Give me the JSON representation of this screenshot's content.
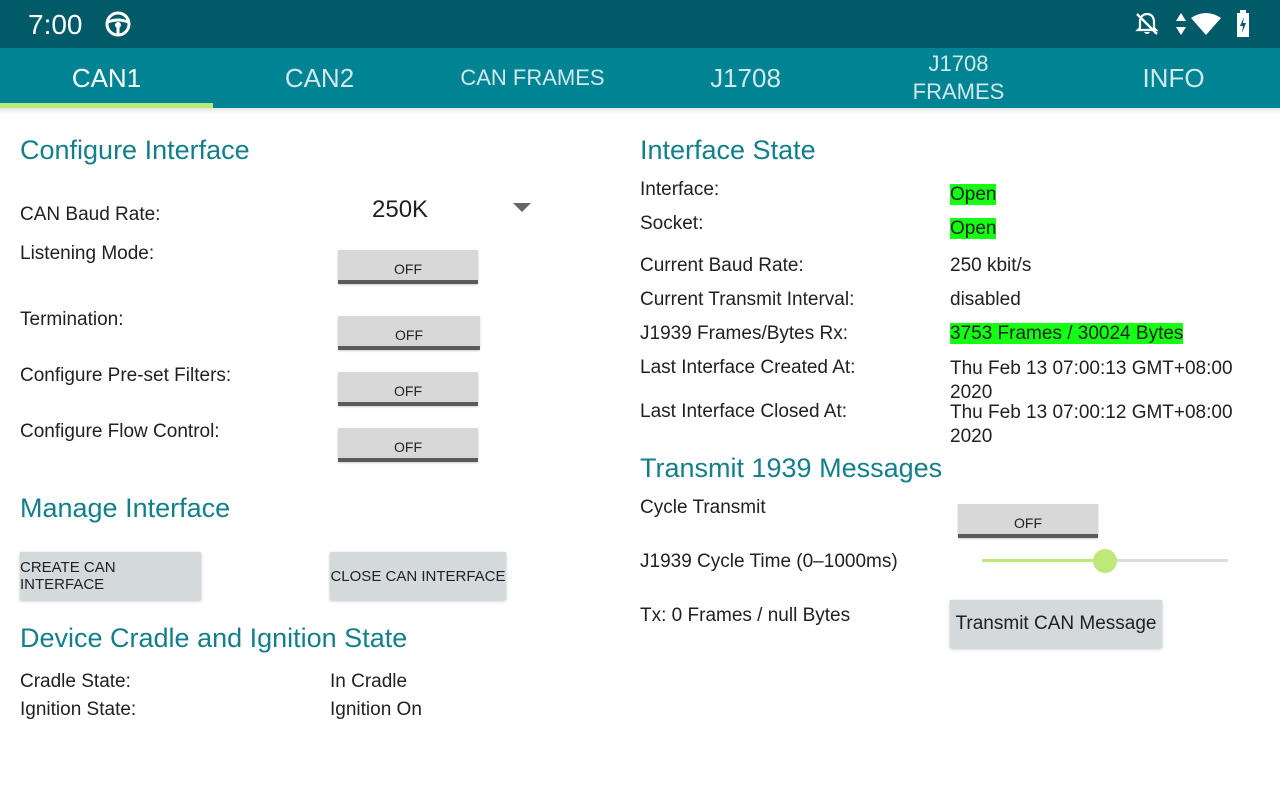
{
  "status_bar": {
    "time": "7:00"
  },
  "tabs": [
    {
      "label": "CAN1",
      "active": true
    },
    {
      "label": "CAN2",
      "active": false
    },
    {
      "label": "CAN FRAMES",
      "active": false
    },
    {
      "label": "J1708",
      "active": false
    },
    {
      "label": "J1708 FRAMES",
      "active": false
    },
    {
      "label": "INFO",
      "active": false
    }
  ],
  "configure": {
    "title": "Configure Interface",
    "baud_label": "CAN Baud Rate:",
    "baud_value": "250K",
    "listening_label": "Listening Mode:",
    "listening_toggle": "OFF",
    "termination_label": "Termination:",
    "termination_toggle": "OFF",
    "filters_label": "Configure Pre-set Filters:",
    "filters_toggle": "OFF",
    "flow_label": "Configure Flow Control:",
    "flow_toggle": "OFF"
  },
  "manage": {
    "title": "Manage Interface",
    "create_button": "CREATE CAN INTERFACE",
    "close_button": "CLOSE CAN INTERFACE"
  },
  "cradle": {
    "title": "Device Cradle and Ignition State",
    "cradle_label": "Cradle State:",
    "cradle_value": "In Cradle",
    "ignition_label": "Ignition State:",
    "ignition_value": "Ignition On"
  },
  "state": {
    "title": "Interface State",
    "interface_label": "Interface:",
    "interface_value": "Open",
    "socket_label": "Socket:",
    "socket_value": "Open",
    "baud_label": "Current Baud Rate:",
    "baud_value": "250 kbit/s",
    "interval_label": "Current Transmit Interval:",
    "interval_value": "disabled",
    "frames_label": "J1939 Frames/Bytes Rx:",
    "frames_value": "3753 Frames / 30024 Bytes",
    "created_label": "Last Interface Created At:",
    "created_value": "Thu Feb 13 07:00:13 GMT+08:00 2020",
    "closed_label": "Last Interface Closed At:",
    "closed_value": "Thu Feb 13 07:00:12 GMT+08:00 2020"
  },
  "transmit": {
    "title": "Transmit 1939 Messages",
    "cycle_label": "Cycle Transmit",
    "cycle_toggle": "OFF",
    "cycle_time_label": "J1939 Cycle Time (0–1000ms)",
    "cycle_time_fraction": 0.5,
    "tx_label": "Tx: 0 Frames / null Bytes",
    "transmit_button": "Transmit CAN Message"
  },
  "colors": {
    "status_bar": "#005a68",
    "tab_bar": "#008392",
    "tab_indicator": "#b9e879",
    "heading": "#127f8a",
    "highlight": "#14ff14"
  }
}
